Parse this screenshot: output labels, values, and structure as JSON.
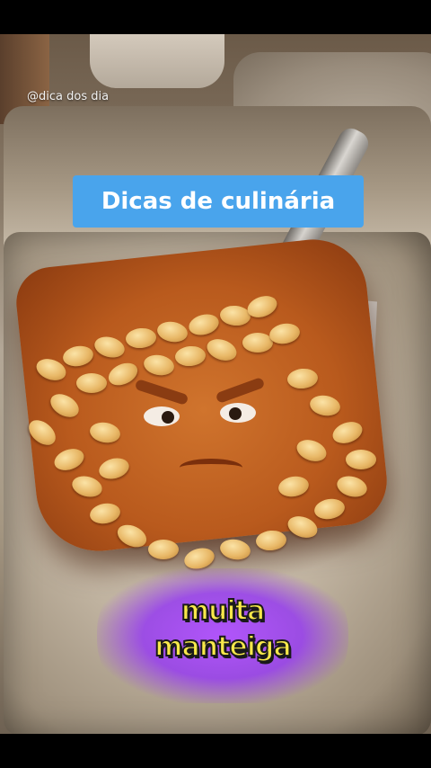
{
  "watermark": "@dica dos dia",
  "title": "Dicas de culinária",
  "caption": {
    "line1": "muita",
    "line2": "manteiga"
  },
  "colors": {
    "title_bg": "#49a4ec",
    "caption_text": "#f7e84a",
    "caption_glow": "#b050ff"
  }
}
